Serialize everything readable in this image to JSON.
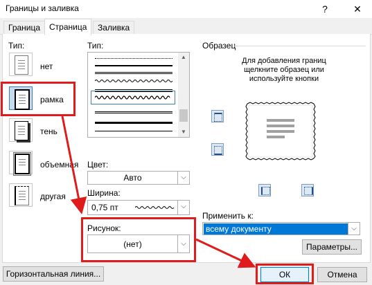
{
  "window": {
    "title": "Границы и заливка",
    "help_label": "?",
    "close_label": "✕"
  },
  "tabs": [
    {
      "label": "Граница"
    },
    {
      "label": "Страница"
    },
    {
      "label": "Заливка"
    }
  ],
  "type_section": {
    "label": "Тип:",
    "items": [
      {
        "label": "нет"
      },
      {
        "label": "рамка"
      },
      {
        "label": "тень"
      },
      {
        "label": "объемная"
      },
      {
        "label": "другая"
      }
    ]
  },
  "style_section": {
    "label": "Тип:"
  },
  "color": {
    "label": "Цвет:",
    "value": "Авто"
  },
  "width": {
    "label": "Ширина:",
    "value": "0,75 пт"
  },
  "art": {
    "label": "Рисунок:",
    "value": "(нет)"
  },
  "preview": {
    "label": "Образец",
    "hint": [
      "Для добавления границ",
      "щелкните образец или",
      "используйте кнопки"
    ]
  },
  "apply": {
    "label": "Применить к:",
    "value": "всему документу"
  },
  "buttons": {
    "options": "Параметры...",
    "horizontal_line": "Горизонтальная линия...",
    "ok": "ОК",
    "cancel": "Отмена"
  },
  "colors": {
    "accent": "#0078d7",
    "highlight_red": "#e01b1b",
    "selection_bg": "#c5d9f1"
  }
}
